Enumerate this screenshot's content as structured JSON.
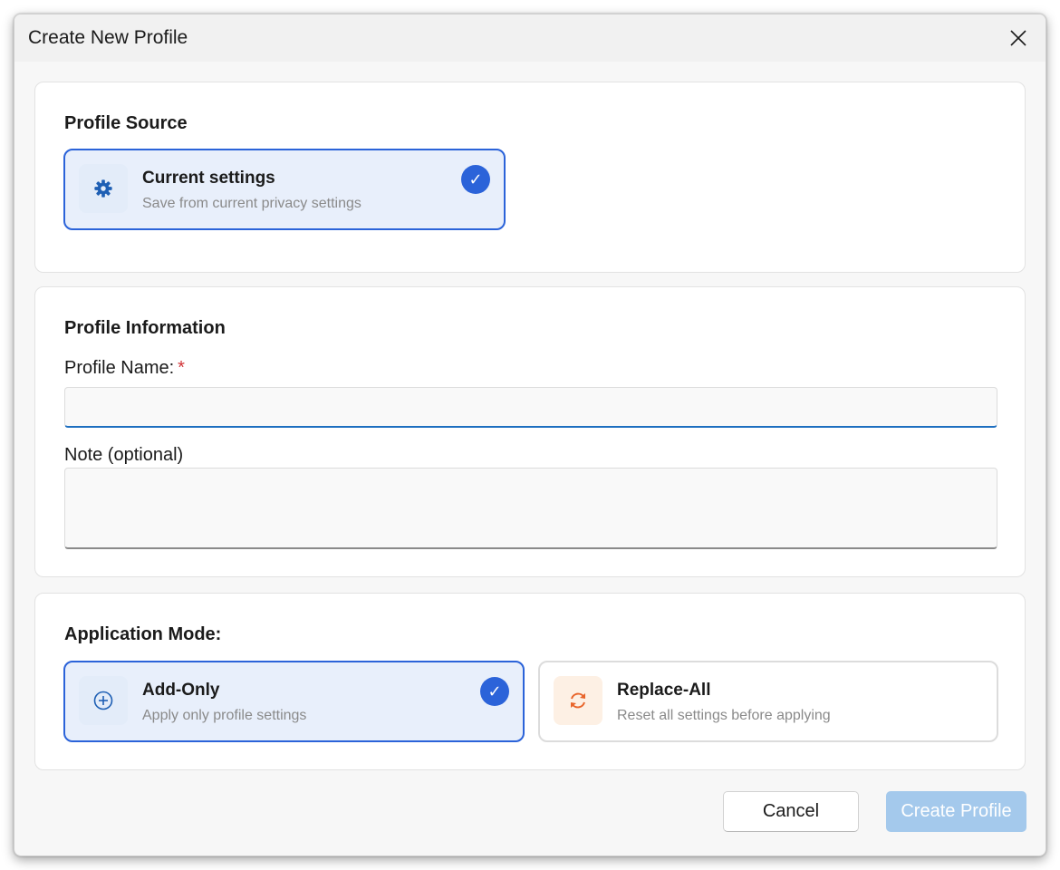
{
  "dialog": {
    "title": "Create New Profile"
  },
  "profile_source": {
    "heading": "Profile Source",
    "option": {
      "title": "Current settings",
      "subtitle": "Save from current privacy settings",
      "icon": "gear-icon",
      "selected": true
    }
  },
  "profile_info": {
    "heading": "Profile Information",
    "name_label": "Profile Name:",
    "name_required_marker": "*",
    "name_value": "",
    "note_label": "Note (optional)",
    "note_value": ""
  },
  "application_mode": {
    "heading": "Application Mode:",
    "options": [
      {
        "title": "Add-Only",
        "subtitle": "Apply only profile settings",
        "icon": "plus-circle-icon",
        "selected": true
      },
      {
        "title": "Replace-All",
        "subtitle": "Reset all settings before applying",
        "icon": "sync-icon",
        "selected": false
      }
    ]
  },
  "buttons": {
    "cancel": "Cancel",
    "create": "Create Profile"
  },
  "colors": {
    "accent": "#2b63d9",
    "accent_light": "#e8effb",
    "required": "#d13438",
    "orange_icon": "#e8642a",
    "disabled_button": "#a4c9ec"
  },
  "check_glyph": "✓"
}
